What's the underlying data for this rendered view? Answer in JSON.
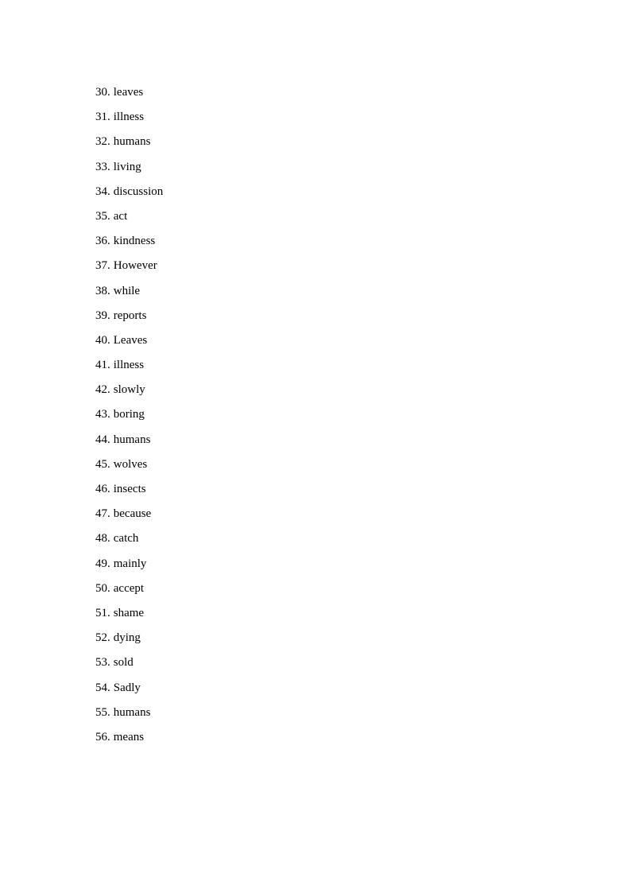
{
  "document": {
    "answers": [
      {
        "number": "30.",
        "word": "leaves"
      },
      {
        "number": "31.",
        "word": "illness"
      },
      {
        "number": "32.",
        "word": "humans"
      },
      {
        "number": "33.",
        "word": "living"
      },
      {
        "number": "34.",
        "word": "discussion"
      },
      {
        "number": "35.",
        "word": "act"
      },
      {
        "number": "36.",
        "word": "kindness"
      },
      {
        "number": "37.",
        "word": "However"
      },
      {
        "number": "38.",
        "word": "while"
      },
      {
        "number": "39.",
        "word": "reports"
      },
      {
        "number": "40.",
        "word": "Leaves"
      },
      {
        "number": "41.",
        "word": "illness"
      },
      {
        "number": "42.",
        "word": "slowly"
      },
      {
        "number": "43.",
        "word": "boring"
      },
      {
        "number": "44.",
        "word": "humans"
      },
      {
        "number": "45.",
        "word": "wolves"
      },
      {
        "number": "46.",
        "word": "insects"
      },
      {
        "number": "47.",
        "word": "because"
      },
      {
        "number": "48.",
        "word": "catch"
      },
      {
        "number": "49.",
        "word": "mainly"
      },
      {
        "number": "50.",
        "word": "accept"
      },
      {
        "number": "51.",
        "word": "shame"
      },
      {
        "number": "52.",
        "word": "dying"
      },
      {
        "number": "53.",
        "word": "sold"
      },
      {
        "number": "54.",
        "word": "Sadly"
      },
      {
        "number": "55.",
        "word": "humans"
      },
      {
        "number": "56.",
        "word": "means"
      }
    ]
  }
}
